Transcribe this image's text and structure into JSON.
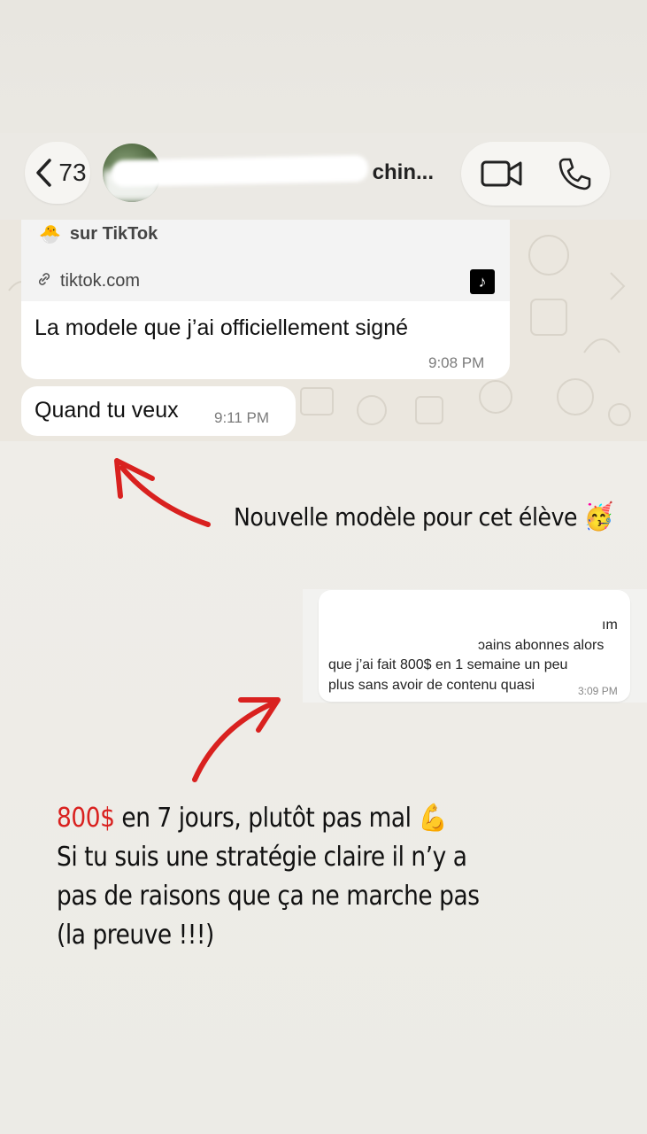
{
  "header": {
    "back_count": "73",
    "contact_name_partial": "chin...",
    "icons": {
      "back": "chevron-left-icon",
      "video": "video-camera-icon",
      "phone": "phone-icon"
    }
  },
  "chat": {
    "link_preview": {
      "title": "sur TikTok",
      "domain": "tiktok.com"
    },
    "messages": [
      {
        "text": "La modele que j’ai officiellement signé",
        "time": "9:08 PM"
      },
      {
        "text": "Quand tu veux",
        "time": "9:11 PM"
      }
    ]
  },
  "annotation_1": {
    "text": "Nouvelle modèle pour cet élève",
    "emoji": "🥳"
  },
  "screenshot_2": {
    "partial_top_right": "ım",
    "partial_line": "ɔains abonnes alors",
    "lines": [
      "que j’ai fait 800$ en 1 semaine un peu",
      "plus sans avoir de contenu quasi"
    ],
    "time": "3:09 PM"
  },
  "annotation_2": {
    "highlight": "800$",
    "line1_rest": " en 7 jours, plutôt pas mal",
    "emoji": "💪",
    "line2": "Si tu suis une stratégie claire il n’y a",
    "line3": "pas de raisons que ça ne marche pas",
    "line4": "(la preuve !!!)"
  },
  "colors": {
    "accent_red": "#d9211f",
    "bubble": "#ffffff",
    "background": "#ece9e3"
  }
}
